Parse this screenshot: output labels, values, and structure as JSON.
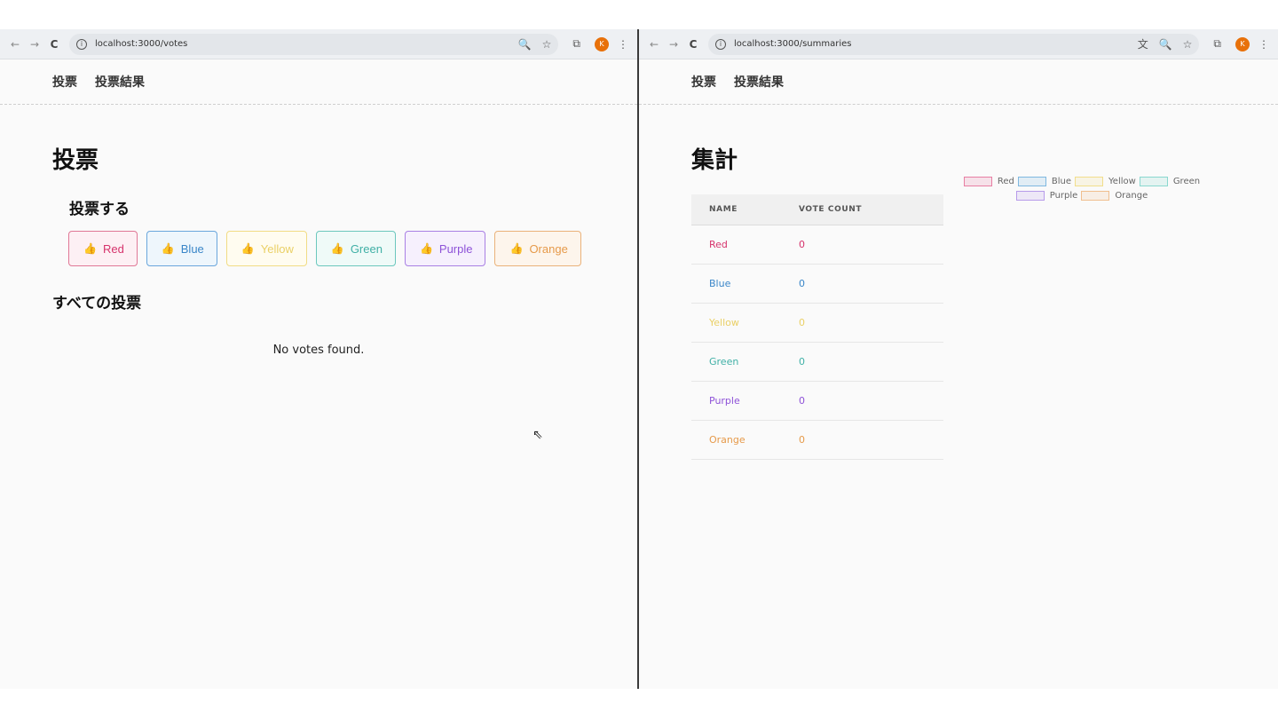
{
  "left_window": {
    "toolbar": {
      "back": "←",
      "forward": "→",
      "reload": "C",
      "url": "localhost:3000/votes",
      "zoom_icon": "🔍",
      "star_icon": "☆",
      "extensions_icon": "⧉",
      "profile_initial": "K",
      "menu_icon": "⋮"
    },
    "nav": {
      "vote_link": "投票",
      "results_link": "投票結果"
    },
    "title": "投票",
    "vote_section_title": "投票する",
    "vote_buttons": [
      {
        "label": "Red",
        "color": "#d6336c",
        "bg": "#fdf0f4",
        "border": "#e07896",
        "icon": "thumbs-up-icon"
      },
      {
        "label": "Blue",
        "color": "#3a86c8",
        "bg": "#eef6fc",
        "border": "#6aa6dc",
        "icon": "thumbs-up-icon"
      },
      {
        "label": "Yellow",
        "color": "#ead066",
        "bg": "#fffcf0",
        "border": "#f1dc85",
        "icon": "thumbs-up-icon"
      },
      {
        "label": "Green",
        "color": "#40b0a6",
        "bg": "#effaf8",
        "border": "#6cc7bd",
        "icon": "thumbs-up-icon"
      },
      {
        "label": "Purple",
        "color": "#8e52d8",
        "bg": "#f6f0fd",
        "border": "#a980e4",
        "icon": "thumbs-up-icon"
      },
      {
        "label": "Orange",
        "color": "#e69a4a",
        "bg": "#fdf5ec",
        "border": "#eab27a",
        "icon": "thumbs-up-icon"
      }
    ],
    "all_votes_title": "すべての投票",
    "empty_message": "No votes found."
  },
  "right_window": {
    "toolbar": {
      "back": "←",
      "forward": "→",
      "reload": "C",
      "url": "localhost:3000/summaries",
      "translate_icon": "文",
      "zoom_icon": "🔍",
      "star_icon": "☆",
      "extensions_icon": "⧉",
      "profile_initial": "K",
      "menu_icon": "⋮"
    },
    "nav": {
      "vote_link": "投票",
      "results_link": "投票結果"
    },
    "title": "集計",
    "table": {
      "headers": [
        "NAME",
        "VOTE COUNT"
      ],
      "rows": [
        {
          "name": "Red",
          "count": "0",
          "color": "#d6336c"
        },
        {
          "name": "Blue",
          "count": "0",
          "color": "#3a86c8"
        },
        {
          "name": "Yellow",
          "count": "0",
          "color": "#ead066"
        },
        {
          "name": "Green",
          "count": "0",
          "color": "#40b0a6"
        },
        {
          "name": "Purple",
          "count": "0",
          "color": "#8e52d8"
        },
        {
          "name": "Orange",
          "count": "0",
          "color": "#e69a4a"
        }
      ]
    },
    "chart_data": {
      "type": "bar",
      "categories": [
        "Red",
        "Blue",
        "Yellow",
        "Green",
        "Purple",
        "Orange"
      ],
      "values": [
        0,
        0,
        0,
        0,
        0,
        0
      ],
      "legend": [
        "Red",
        "Blue",
        "Yellow",
        "Green",
        "Purple",
        "Orange"
      ],
      "legend_position": "top",
      "colors": [
        "#e87fa3",
        "#7fb8e0",
        "#f1de8c",
        "#8ad8cf",
        "#b79bea",
        "#f0bf8f"
      ],
      "title": "",
      "xlabel": "",
      "ylabel": ""
    }
  }
}
